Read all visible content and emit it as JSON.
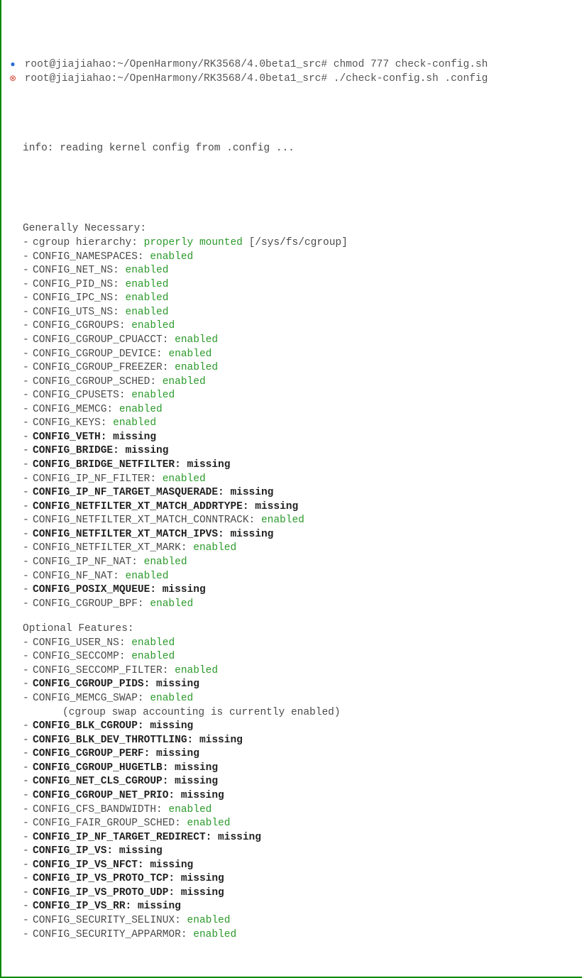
{
  "prompt_lines": [
    {
      "marker": "blue",
      "prompt": "root@jiajiahao:~/OpenHarmony/RK3568/4.0beta1_src#",
      "cmd": "chmod 777 check-config.sh"
    },
    {
      "marker": "red",
      "prompt": "root@jiajiahao:~/OpenHarmony/RK3568/4.0beta1_src#",
      "cmd": "./check-config.sh .config"
    }
  ],
  "info_line": "info: reading kernel config from .config ...",
  "sections": [
    {
      "title": "Generally Necessary:",
      "items": [
        {
          "type": "hier",
          "prefix": "cgroup hierarchy: ",
          "status": "properly mounted",
          "statusClass": "green",
          "suffix": " [/sys/fs/cgroup]"
        },
        {
          "type": "cfg",
          "name": "CONFIG_NAMESPACES",
          "status": "enabled",
          "statusClass": "green"
        },
        {
          "type": "cfg",
          "name": "CONFIG_NET_NS",
          "status": "enabled",
          "statusClass": "green"
        },
        {
          "type": "cfg",
          "name": "CONFIG_PID_NS",
          "status": "enabled",
          "statusClass": "green"
        },
        {
          "type": "cfg",
          "name": "CONFIG_IPC_NS",
          "status": "enabled",
          "statusClass": "green"
        },
        {
          "type": "cfg",
          "name": "CONFIG_UTS_NS",
          "status": "enabled",
          "statusClass": "green"
        },
        {
          "type": "cfg",
          "name": "CONFIG_CGROUPS",
          "status": "enabled",
          "statusClass": "green"
        },
        {
          "type": "cfg",
          "name": "CONFIG_CGROUP_CPUACCT",
          "status": "enabled",
          "statusClass": "green"
        },
        {
          "type": "cfg",
          "name": "CONFIG_CGROUP_DEVICE",
          "status": "enabled",
          "statusClass": "green"
        },
        {
          "type": "cfg",
          "name": "CONFIG_CGROUP_FREEZER",
          "status": "enabled",
          "statusClass": "green"
        },
        {
          "type": "cfg",
          "name": "CONFIG_CGROUP_SCHED",
          "status": "enabled",
          "statusClass": "green"
        },
        {
          "type": "cfg",
          "name": "CONFIG_CPUSETS",
          "status": "enabled",
          "statusClass": "green"
        },
        {
          "type": "cfg",
          "name": "CONFIG_MEMCG",
          "status": "enabled",
          "statusClass": "green"
        },
        {
          "type": "cfg",
          "name": "CONFIG_KEYS",
          "status": "enabled",
          "statusClass": "green"
        },
        {
          "type": "cfg",
          "name": "CONFIG_VETH",
          "status": "missing",
          "statusClass": "red",
          "bold": true
        },
        {
          "type": "cfg",
          "name": "CONFIG_BRIDGE",
          "status": "missing",
          "statusClass": "red",
          "bold": true
        },
        {
          "type": "cfg",
          "name": "CONFIG_BRIDGE_NETFILTER",
          "status": "missing",
          "statusClass": "red",
          "bold": true
        },
        {
          "type": "cfg",
          "name": "CONFIG_IP_NF_FILTER",
          "status": "enabled",
          "statusClass": "green"
        },
        {
          "type": "cfg",
          "name": "CONFIG_IP_NF_TARGET_MASQUERADE",
          "status": "missing",
          "statusClass": "red",
          "bold": true
        },
        {
          "type": "cfg",
          "name": "CONFIG_NETFILTER_XT_MATCH_ADDRTYPE",
          "status": "missing",
          "statusClass": "red",
          "bold": true
        },
        {
          "type": "cfg",
          "name": "CONFIG_NETFILTER_XT_MATCH_CONNTRACK",
          "status": "enabled",
          "statusClass": "green"
        },
        {
          "type": "cfg",
          "name": "CONFIG_NETFILTER_XT_MATCH_IPVS",
          "status": "missing",
          "statusClass": "red",
          "bold": true
        },
        {
          "type": "cfg",
          "name": "CONFIG_NETFILTER_XT_MARK",
          "status": "enabled",
          "statusClass": "green"
        },
        {
          "type": "cfg",
          "name": "CONFIG_IP_NF_NAT",
          "status": "enabled",
          "statusClass": "green"
        },
        {
          "type": "cfg",
          "name": "CONFIG_NF_NAT",
          "status": "enabled",
          "statusClass": "green"
        },
        {
          "type": "cfg",
          "name": "CONFIG_POSIX_MQUEUE",
          "status": "missing",
          "statusClass": "red",
          "bold": true
        },
        {
          "type": "cfg",
          "name": "CONFIG_CGROUP_BPF",
          "status": "enabled",
          "statusClass": "green"
        }
      ]
    },
    {
      "title": "Optional Features:",
      "items": [
        {
          "type": "cfg",
          "name": "CONFIG_USER_NS",
          "status": "enabled",
          "statusClass": "green"
        },
        {
          "type": "cfg",
          "name": "CONFIG_SECCOMP",
          "status": "enabled",
          "statusClass": "green"
        },
        {
          "type": "cfg",
          "name": "CONFIG_SECCOMP_FILTER",
          "status": "enabled",
          "statusClass": "green"
        },
        {
          "type": "cfg",
          "name": "CONFIG_CGROUP_PIDS",
          "status": "missing",
          "statusClass": "red",
          "bold": true
        },
        {
          "type": "cfg",
          "name": "CONFIG_MEMCG_SWAP",
          "status": "enabled",
          "statusClass": "green"
        },
        {
          "type": "note",
          "text": "(cgroup swap accounting is currently enabled)"
        },
        {
          "type": "cfg",
          "name": "CONFIG_BLK_CGROUP",
          "status": "missing",
          "statusClass": "red",
          "bold": true
        },
        {
          "type": "cfg",
          "name": "CONFIG_BLK_DEV_THROTTLING",
          "status": "missing",
          "statusClass": "red",
          "bold": true
        },
        {
          "type": "cfg",
          "name": "CONFIG_CGROUP_PERF",
          "status": "missing",
          "statusClass": "red",
          "bold": true
        },
        {
          "type": "cfg",
          "name": "CONFIG_CGROUP_HUGETLB",
          "status": "missing",
          "statusClass": "red",
          "bold": true
        },
        {
          "type": "cfg",
          "name": "CONFIG_NET_CLS_CGROUP",
          "status": "missing",
          "statusClass": "red",
          "bold": true
        },
        {
          "type": "cfg",
          "name": "CONFIG_CGROUP_NET_PRIO",
          "status": "missing",
          "statusClass": "red",
          "bold": true
        },
        {
          "type": "cfg",
          "name": "CONFIG_CFS_BANDWIDTH",
          "status": "enabled",
          "statusClass": "green"
        },
        {
          "type": "cfg",
          "name": "CONFIG_FAIR_GROUP_SCHED",
          "status": "enabled",
          "statusClass": "green"
        },
        {
          "type": "cfg",
          "name": "CONFIG_IP_NF_TARGET_REDIRECT",
          "status": "missing",
          "statusClass": "red",
          "bold": true
        },
        {
          "type": "cfg",
          "name": "CONFIG_IP_VS",
          "status": "missing",
          "statusClass": "red",
          "bold": true
        },
        {
          "type": "cfg",
          "name": "CONFIG_IP_VS_NFCT",
          "status": "missing",
          "statusClass": "red",
          "bold": true
        },
        {
          "type": "cfg",
          "name": "CONFIG_IP_VS_PROTO_TCP",
          "status": "missing",
          "statusClass": "red",
          "bold": true
        },
        {
          "type": "cfg",
          "name": "CONFIG_IP_VS_PROTO_UDP",
          "status": "missing",
          "statusClass": "red",
          "bold": true
        },
        {
          "type": "cfg",
          "name": "CONFIG_IP_VS_RR",
          "status": "missing",
          "statusClass": "red",
          "bold": true
        },
        {
          "type": "cfg",
          "name": "CONFIG_SECURITY_SELINUX",
          "status": "enabled",
          "statusClass": "green"
        },
        {
          "type": "cfg",
          "name": "CONFIG_SECURITY_APPARMOR",
          "status": "enabled",
          "statusClass": "green"
        }
      ]
    }
  ]
}
